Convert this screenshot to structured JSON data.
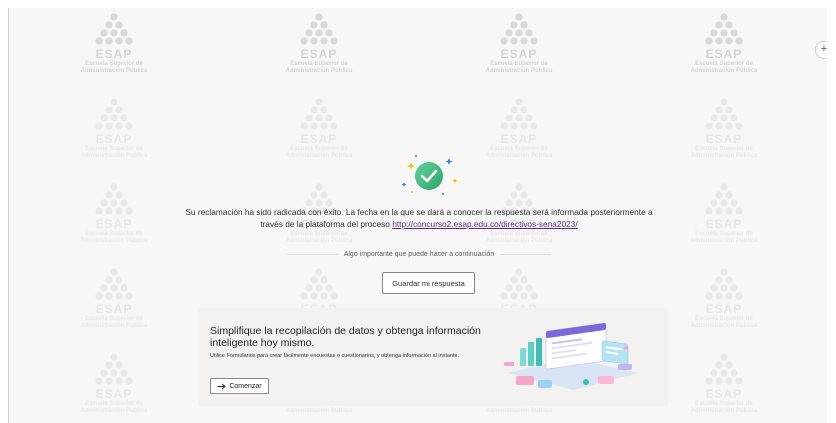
{
  "watermark": {
    "brand": "ESAP",
    "subtitle_line1": "Escuela Superior de",
    "subtitle_line2": "Administración Pública"
  },
  "side_toggle": {
    "glyph": "+"
  },
  "confirmation": {
    "message_before_link": "Su reclamación ha sido radicada con éxito. La fecha en la que se dará a conocer la respuesta será informada posteriormente a través de la plataforma del proceso ",
    "link_text": "http://concurso2.esap.edu.co/directivos-sena2023/",
    "next_steps_label": "Algo importante que puede hacer a continuación",
    "save_label": "Guardar mi respuesta"
  },
  "promo": {
    "title": "Simplifique la recopilación de datos y obtenga información inteligente hoy mismo.",
    "description": "Utilice Formularios para crear fácilmente encuestas o cuestionarios, y obtenga información al instante.",
    "start_label": "Comenzar",
    "start_icon": "arrow-right-icon"
  },
  "colors": {
    "success_green": "#3fbf7f",
    "link_purple": "#5c2d91",
    "background": "#f7f7f7"
  }
}
